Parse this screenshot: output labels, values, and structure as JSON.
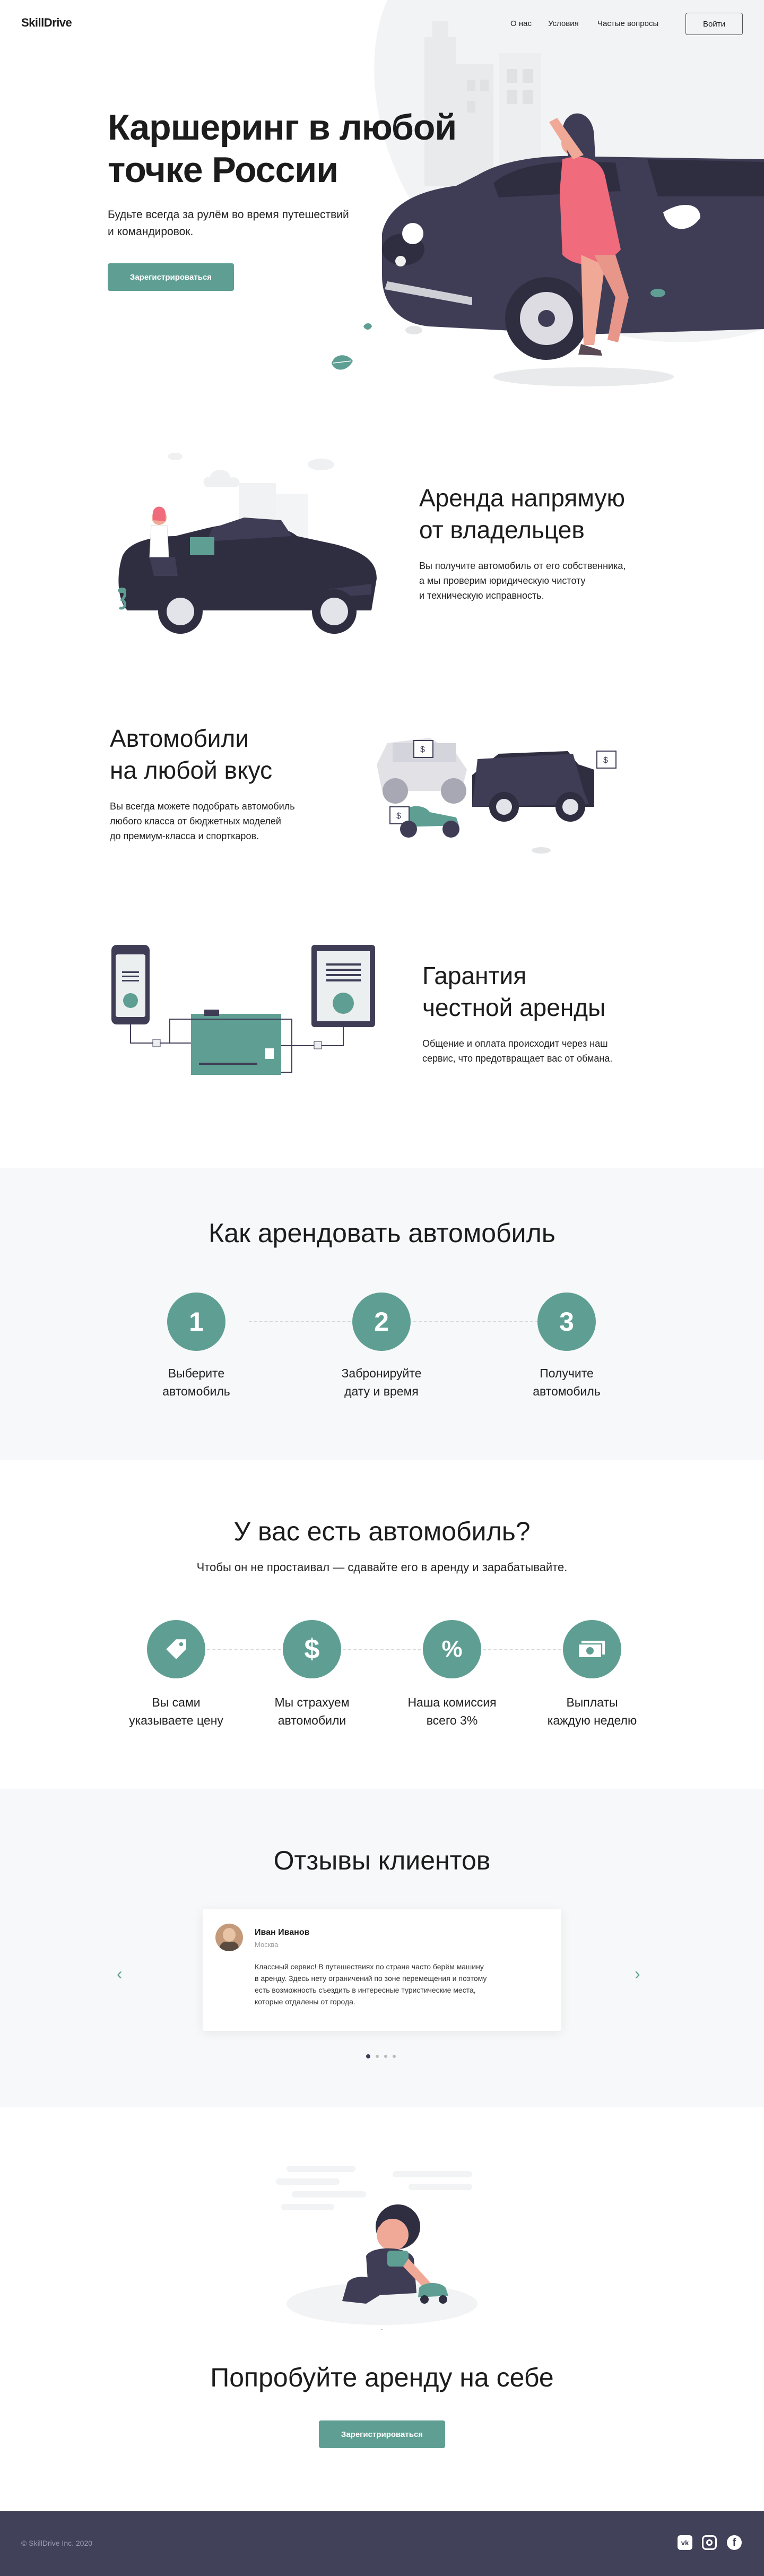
{
  "header": {
    "logo": "SkillDrive",
    "nav": [
      "О нас",
      "Условия",
      "Частые вопросы"
    ],
    "login": "Войти"
  },
  "hero": {
    "title_line1": "Каршеринг в любой",
    "title_line2": "точке России",
    "subtitle_line1": "Будьте всегда за рулём во время путешествий",
    "subtitle_line2": "и командировок.",
    "cta": "Зарегистрироваться"
  },
  "features": [
    {
      "title_line1": "Аренда напрямую",
      "title_line2": "от владельцев",
      "text_lines": [
        "Вы получите автомобиль от его собственника,",
        "а мы проверим юридическую чистоту",
        "и техническую исправность."
      ]
    },
    {
      "title_line1": "Автомобили",
      "title_line2": "на любой вкус",
      "text_lines": [
        "Вы всегда можете подобрать автомобиль",
        "любого класса от бюджетных моделей",
        "до премиум-класса и спорткаров."
      ]
    },
    {
      "title_line1": "Гарантия",
      "title_line2": "честной аренды",
      "text_lines": [
        "Общение и оплата происходит через наш",
        "сервис, что предотвращает вас от обмана."
      ]
    }
  ],
  "how": {
    "title": "Как арендовать автомобиль",
    "steps": [
      {
        "num": "1",
        "line1": "Выберите",
        "line2": "автомобиль"
      },
      {
        "num": "2",
        "line1": "Забронируйте",
        "line2": "дату и время"
      },
      {
        "num": "3",
        "line1": "Получите",
        "line2": "автомобиль"
      }
    ]
  },
  "owners": {
    "title": "У вас есть автомобиль?",
    "subtitle": "Чтобы он не простаивал — сдавайте его в аренду и зарабатывайте.",
    "items": [
      {
        "icon": "tag-icon",
        "line1": "Вы сами",
        "line2": "указываете цену"
      },
      {
        "icon": "dollar-icon",
        "line1": "Мы страхуем",
        "line2": "автомобили"
      },
      {
        "icon": "percent-icon",
        "line1": "Наша комиссия",
        "line2": "всего 3%"
      },
      {
        "icon": "money-icon",
        "line1": "Выплаты",
        "line2": "каждую неделю"
      }
    ]
  },
  "reviews": {
    "title": "Отзывы клиентов",
    "name": "Иван Иванов",
    "city": "Москва",
    "text_lines": [
      "Классный сервис! В путешествиях по стране часто берём машину",
      "в аренду. Здесь нету ограничений по зоне перемещения и поэтому",
      "есть возможность съездить в интересные туристические места,",
      "которые отдалены от города."
    ]
  },
  "try": {
    "title": "Попробуйте аренду на себе",
    "cta": "Зарегистрироваться"
  },
  "footer": {
    "copyright": "© SkillDrive Inc. 2020",
    "social_icons": [
      "vk-icon",
      "instagram-icon",
      "facebook-icon"
    ]
  },
  "colors": {
    "accent": "#5f9f93",
    "dark": "#3f3d56",
    "light_bg": "#f7f8f9",
    "pink": "#f06b7c",
    "footer_bg": "#41415a"
  }
}
